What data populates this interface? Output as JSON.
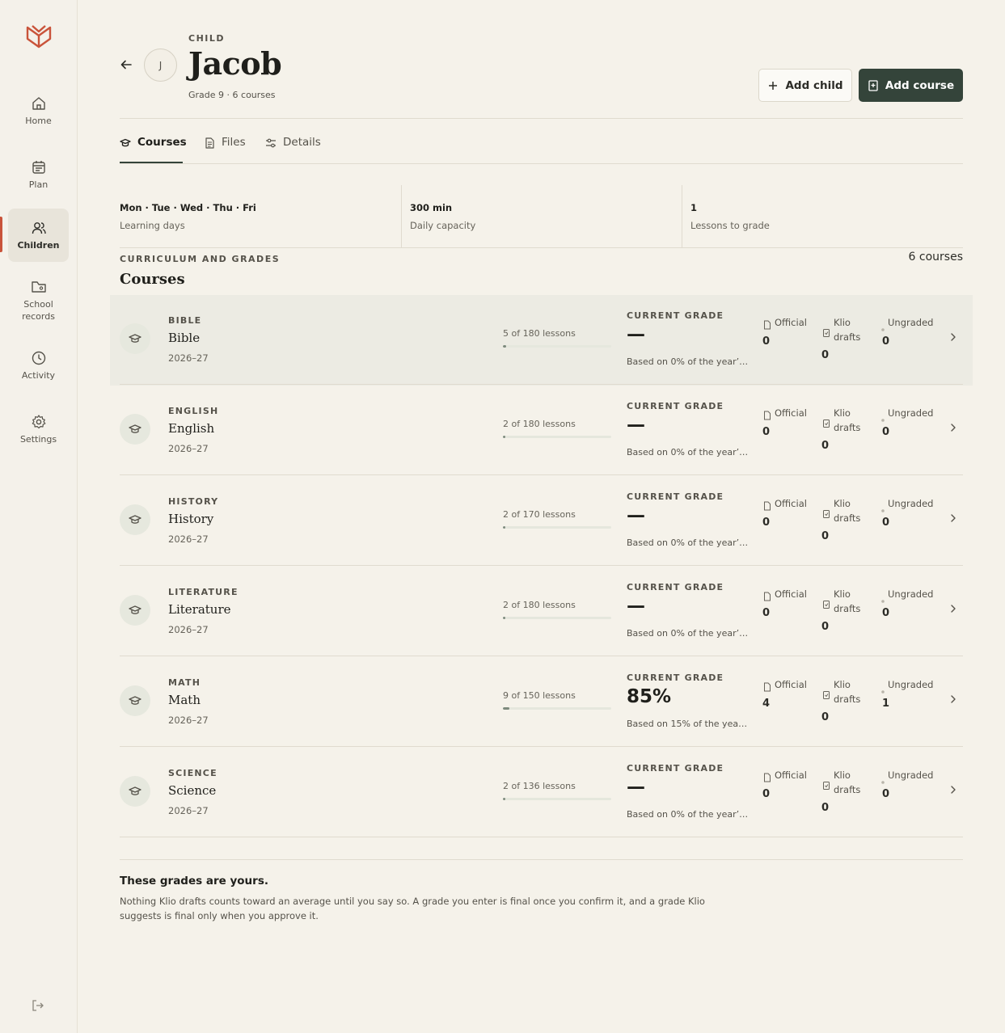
{
  "sidebar": {
    "items": [
      {
        "label": "Home",
        "icon": "home-icon"
      },
      {
        "label": "Plan",
        "icon": "calendar-icon"
      },
      {
        "label": "Children",
        "icon": "users-icon"
      },
      {
        "label": "School records",
        "icon": "folder-icon"
      },
      {
        "label": "Activity",
        "icon": "clock-icon"
      },
      {
        "label": "Settings",
        "icon": "gear-icon"
      }
    ],
    "active": "Children"
  },
  "header": {
    "eyebrow": "CHILD",
    "avatar_initial": "J",
    "title": "Jacob",
    "subtitle": "Grade 9 · 6 courses",
    "add_child_label": "Add child",
    "add_course_label": "Add course"
  },
  "tabs": [
    {
      "label": "Courses",
      "icon": "graduation-cap-icon",
      "active": true
    },
    {
      "label": "Files",
      "icon": "document-icon",
      "active": false
    },
    {
      "label": "Details",
      "icon": "sliders-icon",
      "active": false
    }
  ],
  "stats": [
    {
      "value": "Mon · Tue · Wed · Thu · Fri",
      "label": "Learning days"
    },
    {
      "value": "300 min",
      "label": "Daily capacity"
    },
    {
      "value": "1",
      "label": "Lessons to grade"
    }
  ],
  "section": {
    "eyebrow": "CURRICULUM AND GRADES",
    "title": "Courses",
    "count": "6 courses"
  },
  "courses": [
    {
      "tag": "BIBLE",
      "name": "Bible",
      "year": "2026–27",
      "progress_text": "5 of 180 lessons",
      "progress": 0.028,
      "grade_label": "CURRENT GRADE",
      "grade": "—",
      "basis": "Based on 0% of the year’s…",
      "official_label": "Official",
      "official": "0",
      "drafts_label_1": "Klio",
      "drafts_label_2": "drafts",
      "drafts": "0",
      "ungraded_label": "Ungraded",
      "ungraded": "0"
    },
    {
      "tag": "ENGLISH",
      "name": "English",
      "year": "2026–27",
      "progress_text": "2 of 180 lessons",
      "progress": 0.011,
      "grade_label": "CURRENT GRADE",
      "grade": "—",
      "basis": "Based on 0% of the year’s…",
      "official_label": "Official",
      "official": "0",
      "drafts_label_1": "Klio",
      "drafts_label_2": "drafts",
      "drafts": "0",
      "ungraded_label": "Ungraded",
      "ungraded": "0"
    },
    {
      "tag": "HISTORY",
      "name": "History",
      "year": "2026–27",
      "progress_text": "2 of 170 lessons",
      "progress": 0.012,
      "grade_label": "CURRENT GRADE",
      "grade": "—",
      "basis": "Based on 0% of the year’s…",
      "official_label": "Official",
      "official": "0",
      "drafts_label_1": "Klio",
      "drafts_label_2": "drafts",
      "drafts": "0",
      "ungraded_label": "Ungraded",
      "ungraded": "0"
    },
    {
      "tag": "LITERATURE",
      "name": "Literature",
      "year": "2026–27",
      "progress_text": "2 of 180 lessons",
      "progress": 0.011,
      "grade_label": "CURRENT GRADE",
      "grade": "—",
      "basis": "Based on 0% of the year’s…",
      "official_label": "Official",
      "official": "0",
      "drafts_label_1": "Klio",
      "drafts_label_2": "drafts",
      "drafts": "0",
      "ungraded_label": "Ungraded",
      "ungraded": "0"
    },
    {
      "tag": "MATH",
      "name": "Math",
      "year": "2026–27",
      "progress_text": "9 of 150 lessons",
      "progress": 0.06,
      "grade_label": "CURRENT GRADE",
      "grade": "85%",
      "basis": "Based on 15% of the year’…",
      "official_label": "Official",
      "official": "4",
      "drafts_label_1": "Klio",
      "drafts_label_2": "drafts",
      "drafts": "0",
      "ungraded_label": "Ungraded",
      "ungraded": "1"
    },
    {
      "tag": "SCIENCE",
      "name": "Science",
      "year": "2026–27",
      "progress_text": "2 of 136 lessons",
      "progress": 0.015,
      "grade_label": "CURRENT GRADE",
      "grade": "—",
      "basis": "Based on 0% of the year’s…",
      "official_label": "Official",
      "official": "0",
      "drafts_label_1": "Klio",
      "drafts_label_2": "drafts",
      "drafts": "0",
      "ungraded_label": "Ungraded",
      "ungraded": "0"
    }
  ],
  "note": {
    "title": "These grades are yours.",
    "body": "Nothing Klio drafts counts toward an average until you say so. A grade you enter is final once you confirm it, and a grade Klio suggests is final only when you approve it."
  },
  "colors": {
    "accent": "#c9533a",
    "primary": "#34443a",
    "background": "#f5f2ea"
  }
}
